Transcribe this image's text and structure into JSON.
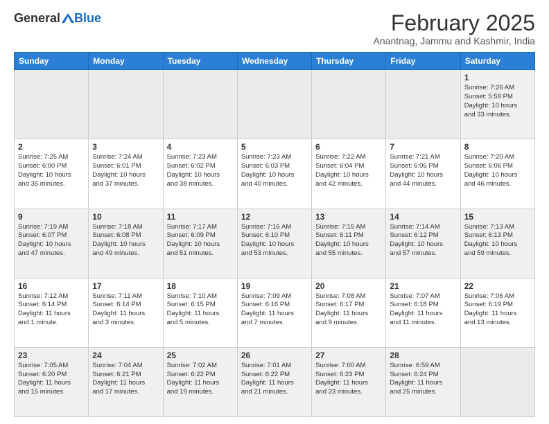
{
  "header": {
    "logo_general": "General",
    "logo_blue": "Blue",
    "month_year": "February 2025",
    "location": "Anantnag, Jammu and Kashmir, India"
  },
  "days_of_week": [
    "Sunday",
    "Monday",
    "Tuesday",
    "Wednesday",
    "Thursday",
    "Friday",
    "Saturday"
  ],
  "weeks": [
    [
      {
        "day": "",
        "info": ""
      },
      {
        "day": "",
        "info": ""
      },
      {
        "day": "",
        "info": ""
      },
      {
        "day": "",
        "info": ""
      },
      {
        "day": "",
        "info": ""
      },
      {
        "day": "",
        "info": ""
      },
      {
        "day": "1",
        "info": "Sunrise: 7:26 AM\nSunset: 5:59 PM\nDaylight: 10 hours\nand 33 minutes."
      }
    ],
    [
      {
        "day": "2",
        "info": "Sunrise: 7:25 AM\nSunset: 6:00 PM\nDaylight: 10 hours\nand 35 minutes."
      },
      {
        "day": "3",
        "info": "Sunrise: 7:24 AM\nSunset: 6:01 PM\nDaylight: 10 hours\nand 37 minutes."
      },
      {
        "day": "4",
        "info": "Sunrise: 7:23 AM\nSunset: 6:02 PM\nDaylight: 10 hours\nand 38 minutes."
      },
      {
        "day": "5",
        "info": "Sunrise: 7:23 AM\nSunset: 6:03 PM\nDaylight: 10 hours\nand 40 minutes."
      },
      {
        "day": "6",
        "info": "Sunrise: 7:22 AM\nSunset: 6:04 PM\nDaylight: 10 hours\nand 42 minutes."
      },
      {
        "day": "7",
        "info": "Sunrise: 7:21 AM\nSunset: 6:05 PM\nDaylight: 10 hours\nand 44 minutes."
      },
      {
        "day": "8",
        "info": "Sunrise: 7:20 AM\nSunset: 6:06 PM\nDaylight: 10 hours\nand 46 minutes."
      }
    ],
    [
      {
        "day": "9",
        "info": "Sunrise: 7:19 AM\nSunset: 6:07 PM\nDaylight: 10 hours\nand 47 minutes."
      },
      {
        "day": "10",
        "info": "Sunrise: 7:18 AM\nSunset: 6:08 PM\nDaylight: 10 hours\nand 49 minutes."
      },
      {
        "day": "11",
        "info": "Sunrise: 7:17 AM\nSunset: 6:09 PM\nDaylight: 10 hours\nand 51 minutes."
      },
      {
        "day": "12",
        "info": "Sunrise: 7:16 AM\nSunset: 6:10 PM\nDaylight: 10 hours\nand 53 minutes."
      },
      {
        "day": "13",
        "info": "Sunrise: 7:15 AM\nSunset: 6:11 PM\nDaylight: 10 hours\nand 55 minutes."
      },
      {
        "day": "14",
        "info": "Sunrise: 7:14 AM\nSunset: 6:12 PM\nDaylight: 10 hours\nand 57 minutes."
      },
      {
        "day": "15",
        "info": "Sunrise: 7:13 AM\nSunset: 6:13 PM\nDaylight: 10 hours\nand 59 minutes."
      }
    ],
    [
      {
        "day": "16",
        "info": "Sunrise: 7:12 AM\nSunset: 6:14 PM\nDaylight: 11 hours\nand 1 minute."
      },
      {
        "day": "17",
        "info": "Sunrise: 7:11 AM\nSunset: 6:14 PM\nDaylight: 11 hours\nand 3 minutes."
      },
      {
        "day": "18",
        "info": "Sunrise: 7:10 AM\nSunset: 6:15 PM\nDaylight: 11 hours\nand 5 minutes."
      },
      {
        "day": "19",
        "info": "Sunrise: 7:09 AM\nSunset: 6:16 PM\nDaylight: 11 hours\nand 7 minutes."
      },
      {
        "day": "20",
        "info": "Sunrise: 7:08 AM\nSunset: 6:17 PM\nDaylight: 11 hours\nand 9 minutes."
      },
      {
        "day": "21",
        "info": "Sunrise: 7:07 AM\nSunset: 6:18 PM\nDaylight: 11 hours\nand 11 minutes."
      },
      {
        "day": "22",
        "info": "Sunrise: 7:06 AM\nSunset: 6:19 PM\nDaylight: 11 hours\nand 13 minutes."
      }
    ],
    [
      {
        "day": "23",
        "info": "Sunrise: 7:05 AM\nSunset: 6:20 PM\nDaylight: 11 hours\nand 15 minutes."
      },
      {
        "day": "24",
        "info": "Sunrise: 7:04 AM\nSunset: 6:21 PM\nDaylight: 11 hours\nand 17 minutes."
      },
      {
        "day": "25",
        "info": "Sunrise: 7:02 AM\nSunset: 6:22 PM\nDaylight: 11 hours\nand 19 minutes."
      },
      {
        "day": "26",
        "info": "Sunrise: 7:01 AM\nSunset: 6:22 PM\nDaylight: 11 hours\nand 21 minutes."
      },
      {
        "day": "27",
        "info": "Sunrise: 7:00 AM\nSunset: 6:23 PM\nDaylight: 11 hours\nand 23 minutes."
      },
      {
        "day": "28",
        "info": "Sunrise: 6:59 AM\nSunset: 6:24 PM\nDaylight: 11 hours\nand 25 minutes."
      },
      {
        "day": "",
        "info": ""
      }
    ]
  ]
}
